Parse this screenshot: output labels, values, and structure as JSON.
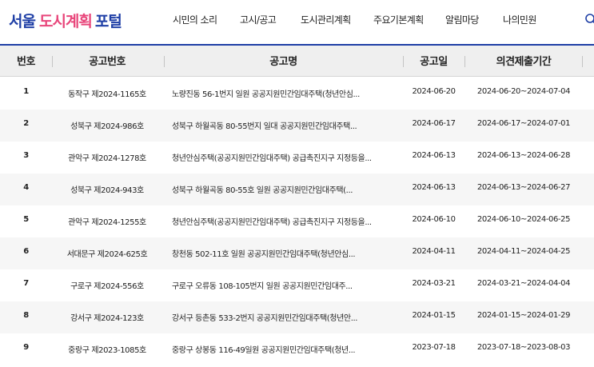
{
  "header": {
    "logo": {
      "part1": "서울",
      "part2": "도시계획",
      "part3": "포털"
    },
    "nav": [
      "시민의 소리",
      "고시/공고",
      "도시관리계획",
      "주요기본계획",
      "알림마당",
      "나의민원"
    ]
  },
  "table": {
    "columns": [
      "번호",
      "공고번호",
      "공고명",
      "공고일",
      "의견제출기간"
    ],
    "rows": [
      {
        "no": "1",
        "notice_no": "동작구 제2024-1165호",
        "title": "노량진동 56-1번지 일원 공공지원민간임대주택(청년안심...",
        "date": "2024-06-20",
        "period": "2024-06-20~2024-07-04"
      },
      {
        "no": "2",
        "notice_no": "성북구 제2024-986호",
        "title": "성북구 하월곡동 80-55번지 일대 공공지원민간임대주택...",
        "date": "2024-06-17",
        "period": "2024-06-17~2024-07-01"
      },
      {
        "no": "3",
        "notice_no": "관악구 제2024-1278호",
        "title": "청년안심주택(공공지원민간임대주택) 공급촉진지구 지정등을...",
        "date": "2024-06-13",
        "period": "2024-06-13~2024-06-28"
      },
      {
        "no": "4",
        "notice_no": "성북구 제2024-943호",
        "title": "성북구 하월곡동 80-55호 일원 공공지원민간임대주택(...",
        "date": "2024-06-13",
        "period": "2024-06-13~2024-06-27"
      },
      {
        "no": "5",
        "notice_no": "관악구 제2024-1255호",
        "title": "청년안심주택(공공지원민간임대주택) 공급촉진지구 지정등을...",
        "date": "2024-06-10",
        "period": "2024-06-10~2024-06-25"
      },
      {
        "no": "6",
        "notice_no": "서대문구 제2024-625호",
        "title": "창천동 502-11호 일원 공공지원민간임대주택(청년안심...",
        "date": "2024-04-11",
        "period": "2024-04-11~2024-04-25"
      },
      {
        "no": "7",
        "notice_no": "구로구 제2024-556호",
        "title": "구로구 오류동 108-105번지 일원 공공지원민간임대주...",
        "date": "2024-03-21",
        "period": "2024-03-21~2024-04-04"
      },
      {
        "no": "8",
        "notice_no": "강서구 제2024-123호",
        "title": "강서구 등촌동 533-2번지 공공지원민간임대주택(청년안...",
        "date": "2024-01-15",
        "period": "2024-01-15~2024-01-29"
      },
      {
        "no": "9",
        "notice_no": "중랑구 제2023-1085호",
        "title": "중랑구 상봉동 116-49일원 공공지원민간임대주택(청년...",
        "date": "2023-07-18",
        "period": "2023-07-18~2023-08-03"
      }
    ]
  },
  "colors": {
    "brand": "#1f3fa6",
    "accent": "#e8457a",
    "header_bg": "#efefef",
    "row_alt": "#f6f6f6"
  },
  "icons": {
    "search": "search-icon"
  }
}
